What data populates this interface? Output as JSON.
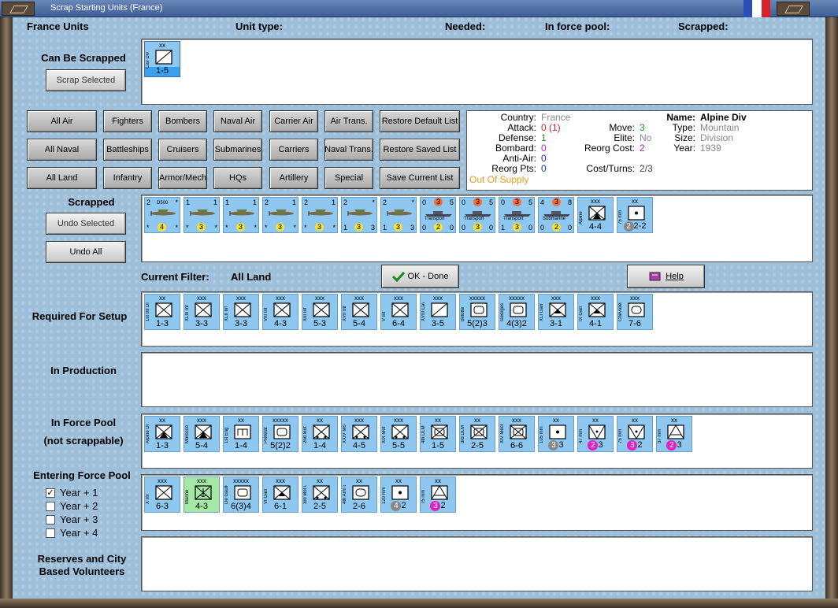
{
  "window": {
    "title": "Scrap Starting Units (France)"
  },
  "header": {
    "units": "France Units",
    "unit_type": "Unit type:",
    "needed": "Needed:",
    "in_force_pool": "In force pool:",
    "scrapped": "Scrapped:"
  },
  "can_be_scrapped": {
    "label": "Can Be Scrapped",
    "button": "Scrap Selected",
    "units": [
      {
        "size": "xx",
        "name": "Cav Div",
        "str": "1-5",
        "sym": "cav"
      }
    ]
  },
  "filters": {
    "row1": [
      "All Air",
      "Fighters",
      "Bombers",
      "Naval Air",
      "Carrier Air",
      "Air Trans.",
      "Restore Default List"
    ],
    "row2": [
      "All Naval",
      "Battleships",
      "Cruisers",
      "Submarines",
      "Carriers",
      "Naval Trans.",
      "Restore Saved List"
    ],
    "row3": [
      "All Land",
      "Infantry",
      "Armor/Mech",
      "HQs",
      "Artillery",
      "Special",
      "Save Current List"
    ]
  },
  "info": {
    "country_label": "Country:",
    "country": "France",
    "attack_label": "Attack:",
    "attack": "0 (1)",
    "defense_label": "Defense:",
    "defense": "1",
    "bombard_label": "Bombard:",
    "bombard": "0",
    "antiair_label": "Anti-Air:",
    "antiair": "0",
    "reorgpts_label": "Reorg Pts:",
    "reorgpts": "0",
    "supply": "Out Of Supply",
    "move_label": "Move:",
    "move": "3",
    "elite_label": "Elite:",
    "elite": "No",
    "reorgcost_label": "Reorg Cost:",
    "reorgcost": "2",
    "costturns_label": "Cost/Turns:",
    "costturns": "2/3",
    "name_label": "Name:",
    "name": "Alpine Div",
    "type_label": "Type:",
    "type": "Mountain",
    "size_label": "Size:",
    "size": "Division",
    "year_label": "Year:",
    "year": "1939"
  },
  "scrapped": {
    "label": "Scrapped",
    "undo_selected": "Undo Selected",
    "undo_all": "Undo All",
    "air": [
      {
        "tl": "2",
        "tr": "*",
        "name": "D500",
        "cost": "4",
        "bl": "*",
        "br": "*",
        "plane": "D500"
      },
      {
        "tl": "1",
        "tr": "1",
        "cost": "3",
        "bl": "*",
        "br": "*",
        "plane": "F3F"
      },
      {
        "tl": "1",
        "tr": "1",
        "cost": "3",
        "bl": "*",
        "br": "*",
        "plane": "F3F"
      },
      {
        "tl": "2",
        "tr": "1",
        "cost": "3",
        "bl": "*",
        "br": "*",
        "plane": "F3F"
      },
      {
        "tl": "2",
        "tr": "1",
        "cost": "3",
        "bl": "*",
        "br": "*",
        "plane": "F3F"
      },
      {
        "tl": "2",
        "tr": "*",
        "cost": "3",
        "bl": "1",
        "br": "3",
        "plane": "Amiot 143"
      },
      {
        "tl": "2",
        "tr": "*",
        "cost": "3",
        "bl": "1",
        "br": "3",
        "plane": "Amiot 143"
      }
    ],
    "naval": [
      {
        "tl": "0",
        "tr": "5",
        "top": "3",
        "cost": "2",
        "bl": "0",
        "br": "0",
        "ship": "Transport"
      },
      {
        "tl": "0",
        "tr": "5",
        "top": "3",
        "cost": "3",
        "bl": "0",
        "br": "0",
        "ship": "Transport"
      },
      {
        "tl": "0",
        "tr": "5",
        "top": "3",
        "cost": "3",
        "bl": "1",
        "br": "0",
        "ship": "Transport"
      },
      {
        "tl": "4",
        "tr": "8",
        "top": "3",
        "cost": "2",
        "bl": "0",
        "br": "0",
        "ship": "Submarine"
      }
    ],
    "land": [
      {
        "size": "xxx",
        "name": "Alpine",
        "str": "4-4",
        "sym": "mtn"
      },
      {
        "size": "xx",
        "name": "75 mm",
        "str": "2-2",
        "sym": "art",
        "circle": "2"
      }
    ]
  },
  "filter": {
    "label": "Current Filter:",
    "value": "All Land"
  },
  "actions": {
    "ok": "OK - Done",
    "help": "Help"
  },
  "required": {
    "label": "Required For Setup",
    "units": [
      {
        "size": "xx",
        "name": "1st Inf Div",
        "str": "1-3",
        "sym": "inf"
      },
      {
        "size": "xxx",
        "name": "XLIII Inf",
        "str": "3-3",
        "sym": "inf"
      },
      {
        "size": "xxx",
        "name": "XLII Inf",
        "str": "3-3",
        "sym": "inf"
      },
      {
        "size": "xxx",
        "name": "VIII Inf",
        "str": "4-3",
        "sym": "inf"
      },
      {
        "size": "xxx",
        "name": "XIII Inf",
        "str": "5-3",
        "sym": "inf"
      },
      {
        "size": "xxx",
        "name": "XVII Inf",
        "str": "5-4",
        "sym": "inf"
      },
      {
        "size": "xxx",
        "name": "V Inf",
        "str": "6-4",
        "sym": "inf"
      },
      {
        "size": "xxx",
        "name": "XVIII Cav",
        "str": "3-5",
        "sym": "cav"
      },
      {
        "size": "xxxxx",
        "name": "Billotte",
        "str": "5(2)3",
        "sym": "hq"
      },
      {
        "size": "xxxxx",
        "name": "Georges",
        "str": "4(3)2",
        "sym": "hq"
      },
      {
        "size": "xxx",
        "name": "XLI Garr",
        "str": "3-1",
        "sym": "garr"
      },
      {
        "size": "xxx",
        "name": "IX Garr",
        "str": "4-1",
        "sym": "garr"
      },
      {
        "size": "xxx",
        "name": "Chevalier",
        "str": "7-6",
        "sym": "arm"
      }
    ]
  },
  "production": {
    "label": "In Production"
  },
  "force_pool": {
    "label1": "In Force Pool",
    "label2": "(not scrappable)",
    "units": [
      {
        "size": "xx",
        "name": "Alpine Div",
        "str": "1-3",
        "sym": "mtn"
      },
      {
        "size": "xxx",
        "name": "Morocco",
        "str": "5-4",
        "sym": "mtn"
      },
      {
        "size": "xx",
        "name": "1st Eng",
        "str": "1-4",
        "sym": "eng"
      },
      {
        "size": "xxxxx",
        "name": "Prételat",
        "str": "5(2)2",
        "sym": "hq"
      },
      {
        "size": "xx",
        "name": "2nd Mot Div",
        "str": "1-4",
        "sym": "mot"
      },
      {
        "size": "xxx",
        "name": "XXIV Mot",
        "str": "4-5",
        "sym": "mot"
      },
      {
        "size": "xxx",
        "name": "XIX Mot",
        "str": "5-5",
        "sym": "mot"
      },
      {
        "size": "xx",
        "name": "4th DLM Div",
        "str": "1-5",
        "sym": "mech"
      },
      {
        "size": "xx",
        "name": "3rd DLM Div",
        "str": "2-5",
        "sym": "mech"
      },
      {
        "size": "xxx",
        "name": "XIV Mech",
        "str": "6-6",
        "sym": "mech"
      },
      {
        "size": "xx",
        "name": "105 mm",
        "str": "3",
        "sym": "art",
        "circle": "3",
        "cc": "#888"
      },
      {
        "size": "xx",
        "name": "47 mm",
        "str": "3",
        "sym": "at",
        "circle": "2",
        "cc": "#e020c0"
      },
      {
        "size": "xx",
        "name": "75 mm",
        "str": "2",
        "sym": "at",
        "circle": "3",
        "cc": "#e020c0"
      },
      {
        "size": "xx",
        "name": "37 mm",
        "str": "3",
        "sym": "aa",
        "circle": "2",
        "cc": "#e020c0"
      }
    ]
  },
  "entering": {
    "label": "Entering Force Pool",
    "years": [
      {
        "label": "Year + 1",
        "checked": "✓"
      },
      {
        "label": "Year + 2",
        "checked": ""
      },
      {
        "label": "Year + 3",
        "checked": ""
      },
      {
        "label": "Year + 4",
        "checked": ""
      }
    ],
    "units": [
      {
        "size": "xxx",
        "name": "X Inf",
        "str": "6-3",
        "sym": "inf"
      },
      {
        "size": "xxx",
        "name": "Marine",
        "str": "4-3",
        "sym": "marine",
        "green": true
      },
      {
        "size": "xxxxx",
        "name": "De Gaulle",
        "str": "6(3)4",
        "sym": "hq"
      },
      {
        "size": "xxx",
        "name": "VI Garr",
        "str": "6-1",
        "sym": "garr"
      },
      {
        "size": "xx",
        "name": "3rd Mot Div",
        "str": "2-5",
        "sym": "mot"
      },
      {
        "size": "xx",
        "name": "4th Arm Div",
        "str": "2-6",
        "sym": "arm"
      },
      {
        "size": "xx",
        "name": "120 mm",
        "str": "2",
        "sym": "art",
        "circle": "4",
        "cc": "#888"
      },
      {
        "size": "xx",
        "name": "75 mm",
        "str": "2",
        "sym": "aa",
        "circle": "3",
        "cc": "#e020c0"
      }
    ]
  },
  "reserves": {
    "label1": "Reserves and City",
    "label2": "Based Volunteers"
  }
}
